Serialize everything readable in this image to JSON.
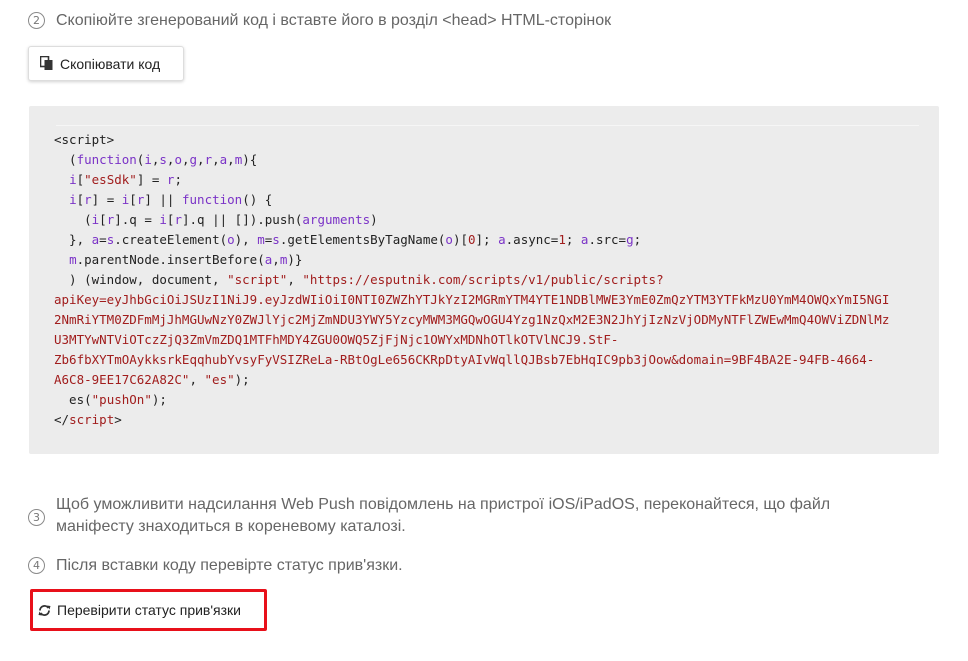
{
  "steps": {
    "step2": {
      "num": "2",
      "text": "Скопіюйте згенерований код і вставте його в розділ <head> HTML-сторінок"
    },
    "step3": {
      "num": "3",
      "text": "Щоб уможливити надсилання Web Push повідомлень на пристрої iOS/iPadOS, переконайтеся, що файл маніфесту знаходиться в кореневому каталозі."
    },
    "step4": {
      "num": "4",
      "text": "Після вставки коду перевірте статус прив'язки."
    }
  },
  "buttons": {
    "copy_label": "Скопіювати код",
    "check_label": "Перевірити статус прив'язки"
  },
  "icons": {
    "copy": "copy-icon",
    "refresh": "refresh-icon"
  },
  "code": {
    "l01": "<script>",
    "l02a": "  (",
    "l02b": "function",
    "l02c": "(",
    "l02d": "i",
    "l02e": ",",
    "l02f": "s",
    "l02g": ",",
    "l02h": "o",
    "l02i": ",",
    "l02j": "g",
    "l02k": ",",
    "l02l": "r",
    "l02m": ",",
    "l02n": "a",
    "l02o": ",",
    "l02p": "m",
    "l02q": "){",
    "l03a": "  ",
    "l03b": "i",
    "l03c": "[",
    "l03d": "\"esSdk\"",
    "l03e": "] = ",
    "l03f": "r",
    "l03g": ";",
    "l04a": "  ",
    "l04b": "i",
    "l04c": "[",
    "l04d": "r",
    "l04e": "] = ",
    "l04f": "i",
    "l04g": "[",
    "l04h": "r",
    "l04i": "] || ",
    "l04j": "function",
    "l04k": "() {",
    "l05a": "    (",
    "l05b": "i",
    "l05c": "[",
    "l05d": "r",
    "l05e": "].q = ",
    "l05f": "i",
    "l05g": "[",
    "l05h": "r",
    "l05i": "].q || []).push(",
    "l05j": "arguments",
    "l05k": ")",
    "l06a": "  }, ",
    "l06b": "a",
    "l06c": "=",
    "l06d": "s",
    "l06e": ".createElement(",
    "l06f": "o",
    "l06g": "), ",
    "l06h": "m",
    "l06i": "=",
    "l06j": "s",
    "l06k": ".getElementsByTagName(",
    "l06l": "o",
    "l06m": ")[",
    "l06n": "0",
    "l06o": "]; ",
    "l06p": "a",
    "l06q": ".async=",
    "l06r": "1",
    "l06s": "; ",
    "l06t": "a",
    "l06u": ".src=",
    "l06v": "g",
    "l06w": ";",
    "l07a": "  ",
    "l07b": "m",
    "l07c": ".parentNode.insertBefore(",
    "l07d": "a",
    "l07e": ",",
    "l07f": "m",
    "l07g": ")}",
    "l08a": "  ) (window, document, ",
    "l08b": "\"script\"",
    "l08c": ", ",
    "l08d": "\"https://esputnik.com/scripts/v1/public/scripts?",
    "l09": "apiKey=eyJhbGciOiJSUzI1NiJ9.eyJzdWIiOiI0NTI0ZWZhYTJkYzI2MGRmYTM4YTE1NDBlMWE3YmE0ZmQzYTM3YTFkMzU0YmM4OWQxYmI5NGI",
    "l10": "2NmRiYTM0ZDFmMjJhMGUwNzY0ZWJlYjc2MjZmNDU3YWY5YzcyMWM3MGQwOGU4Yzg1NzQxM2E3N2JhYjIzNzVjODMyNTFlZWEwMmQ4OWViZDNlMz",
    "l11": "U3MTYwNTViOTczZjQ3ZmVmZDQ1MTFhMDY4ZGU0OWQ5ZjFjNjc1OWYxMDNhOTlkOTVlNCJ9.StF-",
    "l12": "Zb6fbXYTmOAykksrkEqqhubYvsyFyVSIZReLa-RBtOgLe656CKRpDtyAIvWqllQJBsb7EbHqIC9pb3jOow&domain=9BF4BA2E-94FB-4664-",
    "l13a": "A6C8-9EE17C62A82C\"",
    "l13b": ", ",
    "l13c": "\"es\"",
    "l13d": ");",
    "l14a": "  es(",
    "l14b": "\"pushOn\"",
    "l14c": ");",
    "l15a": "</",
    "l15b": "script",
    "l15c": ">"
  }
}
